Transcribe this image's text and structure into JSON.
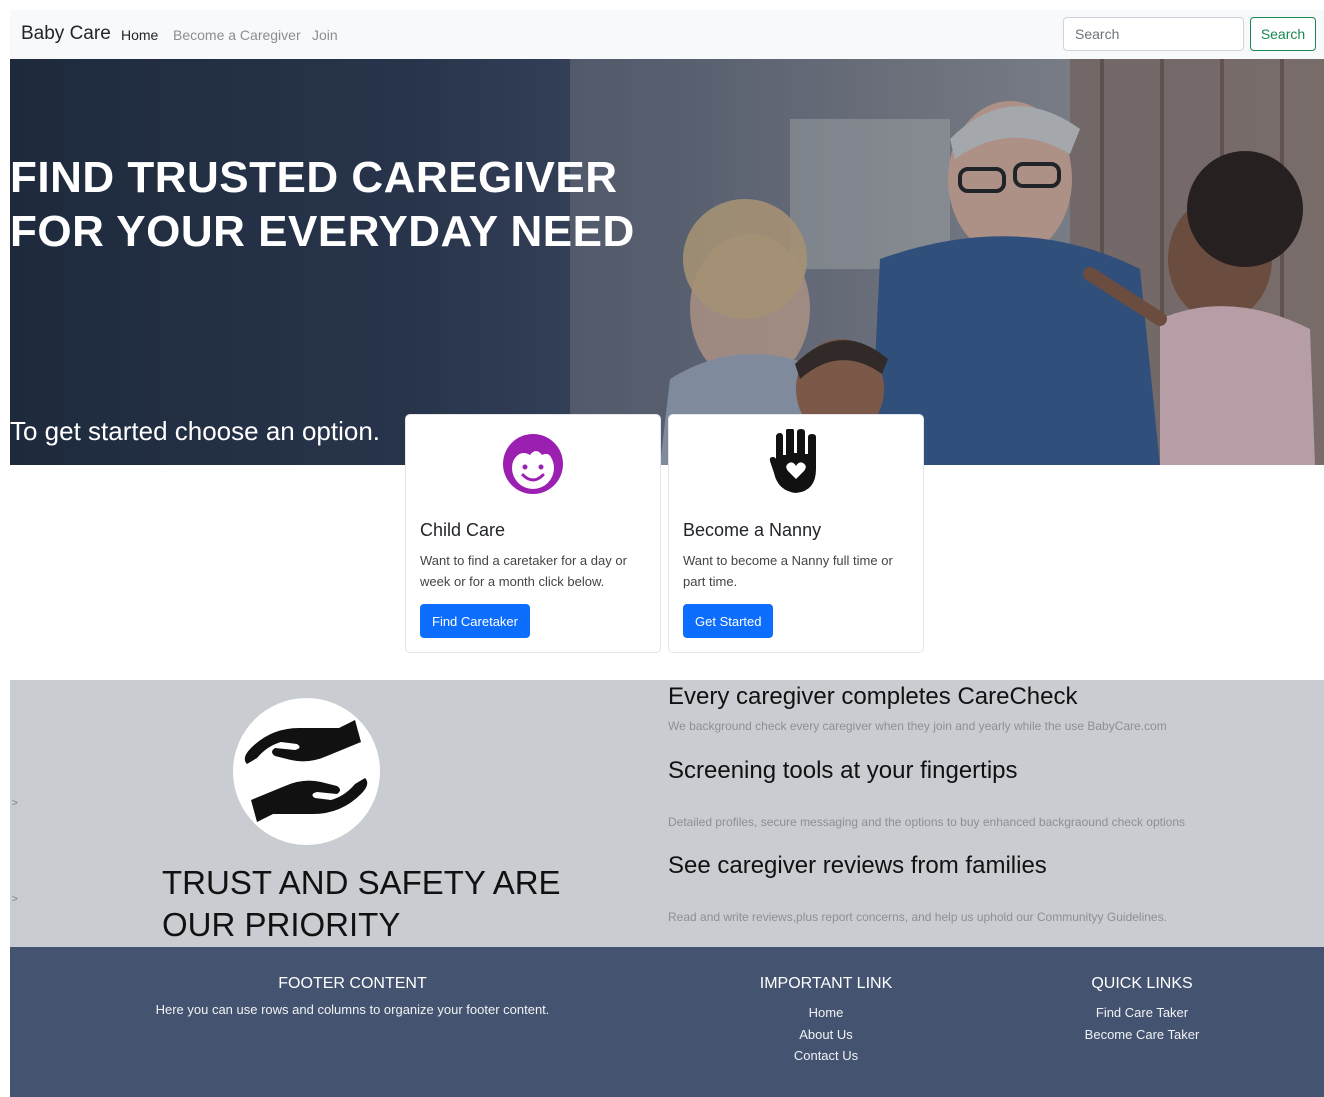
{
  "navbar": {
    "brand": "Baby Care",
    "links": [
      "Home",
      "Become a Caregiver",
      "Join"
    ],
    "search_placeholder": "Search",
    "search_button": "Search"
  },
  "hero": {
    "title": "FIND TRUSTED CAREGIVER FOR YOUR EVERYDAY NEED",
    "subtitle": "To get started choose an option."
  },
  "cards": [
    {
      "icon": "child-face-icon",
      "title": "Child Care",
      "text": "Want to find a caretaker for a day or week or for a month click below.",
      "button": "Find Caretaker"
    },
    {
      "icon": "hand-heart-icon",
      "title": "Become a Nanny",
      "text": "Want to become a Nanny full time or part time.",
      "button": "Get Started"
    }
  ],
  "trust": {
    "icon": "caring-hands-icon",
    "heading": "TRUST AND SAFETY ARE OUR PRIORITY",
    "carets": [
      ">",
      ">"
    ],
    "features": [
      {
        "title": "Every caregiver completes CareCheck",
        "desc": "We background check every caregiver when they join and yearly while the use BabyCare.com"
      },
      {
        "title": "Screening tools at your fingertips",
        "desc": "Detailed profiles, secure messaging and the options to buy enhanced backgraound check options"
      },
      {
        "title": "See caregiver reviews from families",
        "desc": "Read and write reviews,plus report concerns, and help us uphold our Communityy Guidelines."
      }
    ]
  },
  "footer": {
    "content": {
      "heading": "FOOTER CONTENT",
      "text": "Here you can use rows and columns to organize your footer content."
    },
    "important": {
      "heading": "IMPORTANT LINK",
      "links": [
        "Home",
        "About Us",
        "Contact Us"
      ]
    },
    "quick": {
      "heading": "QUICK LINKS",
      "links": [
        "Find Care Taker",
        "Become Care Taker"
      ]
    }
  },
  "colors": {
    "primary": "#0d6efd",
    "success": "#198754",
    "footer_bg": "#44536f",
    "trust_bg": "#c9ccd0",
    "child_icon": "#9b1fb1"
  }
}
